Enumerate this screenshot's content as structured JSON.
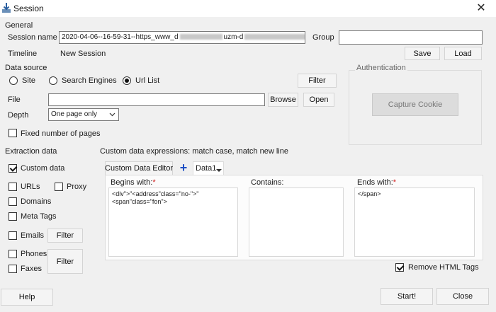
{
  "window": {
    "title": "Session",
    "close_glyph": "✕"
  },
  "general": {
    "section_label": "General",
    "session_name_label": "Session name",
    "session_name_prefix": "2020-04-06--16-59-31--https_www_d",
    "session_name_mid": "uzm-d",
    "session_name_suffix": "n",
    "group_label": "Group",
    "group_value": "",
    "timeline_label": "Timeline",
    "timeline_value": "New Session",
    "save_label": "Save",
    "load_label": "Load"
  },
  "data_source": {
    "section_label": "Data source",
    "options": [
      {
        "label": "Site",
        "checked": false
      },
      {
        "label": "Search Engines",
        "checked": false
      },
      {
        "label": "Url List",
        "checked": true
      }
    ],
    "filter_label": "Filter",
    "file_label": "File",
    "file_value": "",
    "browse_label": "Browse",
    "open_label": "Open",
    "depth_label": "Depth",
    "depth_value": "One page only",
    "fixed_pages_label": "Fixed number of pages"
  },
  "authentication": {
    "section_label": "Authentication",
    "capture_cookie_label": "Capture Cookie"
  },
  "extraction": {
    "section_label": "Extraction data",
    "custom_data_label": "Custom data",
    "urls_label": "URLs",
    "proxy_label": "Proxy",
    "domains_label": "Domains",
    "meta_tags_label": "Meta Tags",
    "emails_label": "Emails",
    "phones_label": "Phones",
    "faxes_label": "Faxes",
    "filter_label": "Filter"
  },
  "custom_expr": {
    "section_label": "Custom data expressions: match case, match new line",
    "editor_button_label": "Custom Data Editor",
    "add_glyph": "+",
    "data_tab_label": "Data1",
    "begins_with_label": "Begins with:",
    "begins_with_value": "<div\">\"<address\"class=\"no-\">\"\n<span\"class=\"fon\">",
    "contains_label": "Contains:",
    "contains_value": "",
    "ends_with_label": "Ends with:",
    "ends_with_value": "</span>",
    "required_mark": "*",
    "remove_html_label": "Remove HTML Tags"
  },
  "footer": {
    "help_label": "Help",
    "start_label": "Start!",
    "close_label": "Close"
  }
}
